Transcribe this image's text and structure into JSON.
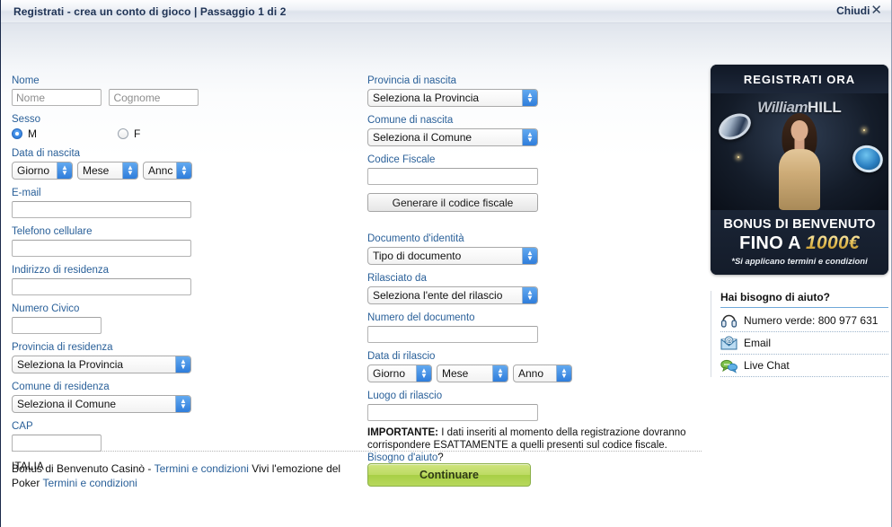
{
  "window": {
    "title": "Registrati - crea un conto di gioco  |  Passaggio 1 di 2",
    "close_label": "Chiudi",
    "close_icon": "close-x-icon"
  },
  "form": {
    "nome": {
      "label": "Nome",
      "first_placeholder": "Nome",
      "first_value": "",
      "last_placeholder": "Cognome",
      "last_value": ""
    },
    "sesso": {
      "label": "Sesso",
      "options": [
        "M",
        "F"
      ],
      "selected": "M"
    },
    "data_nascita": {
      "label": "Data di nascita",
      "day": "Giorno",
      "month": "Mese",
      "year": "Annc"
    },
    "email": {
      "label": "E-mail",
      "value": ""
    },
    "telefono": {
      "label": "Telefono cellulare",
      "value": ""
    },
    "indirizzo": {
      "label": "Indirizzo di residenza",
      "value": ""
    },
    "civico": {
      "label": "Numero Civico",
      "value": ""
    },
    "provincia_res": {
      "label": "Provincia di residenza",
      "value": "Seleziona la Provincia"
    },
    "comune_res": {
      "label": "Comune di residenza",
      "value": "Seleziona il Comune"
    },
    "cap": {
      "label": "CAP",
      "value": ""
    },
    "paese": "ITALIA",
    "provincia_nascita": {
      "label": "Provincia di nascita",
      "value": "Seleziona la Provincia"
    },
    "comune_nascita": {
      "label": "Comune di nascita",
      "value": "Seleziona il Comune"
    },
    "codice_fiscale": {
      "label": "Codice Fiscale",
      "value": ""
    },
    "genera_cf_button": "Generare il codice fiscale",
    "documento": {
      "label": "Documento d'identità",
      "value": "Tipo di documento"
    },
    "rilasciato_da": {
      "label": "Rilasciato da",
      "value": "Seleziona l'ente del rilascio"
    },
    "numero_documento": {
      "label": "Numero del documento",
      "value": ""
    },
    "data_rilascio": {
      "label": "Data di rilascio",
      "day": "Giorno",
      "month": "Mese",
      "year": "Anno"
    },
    "luogo_rilascio": {
      "label": "Luogo di rilascio",
      "value": ""
    },
    "importante": {
      "bold": "IMPORTANTE:",
      "text": " I dati inseriti al momento della registrazione dovranno corrispondere ESATTAMENTE a quelli presenti sul codice fiscale. ",
      "link": "Bisogno d'aiuto",
      "suffix": "?"
    }
  },
  "promo": {
    "header": "REGISTRATI ORA",
    "brand_first": "William",
    "brand_second": "HILL",
    "bonus_line1": "BONUS DI BENVENUTO",
    "bonus_line2_prefix": "FINO A ",
    "bonus_amount": "1000€",
    "terms": "*Si applicano termini e condizioni"
  },
  "help": {
    "title": "Hai bisogno di aiuto?",
    "items": [
      {
        "icon": "headset-icon",
        "label": "Numero verde: 800 977 631"
      },
      {
        "icon": "email-icon",
        "label": "Email"
      },
      {
        "icon": "live-chat-icon",
        "label": "Live Chat"
      }
    ]
  },
  "footer": {
    "text1": "Bonus di Benvenuto Casinò - ",
    "link1": "Termini e condizioni",
    "text2": " Vivi l'emozione del Poker ",
    "link2": "Termini e condizioni",
    "continue_button": "Continuare"
  },
  "colors": {
    "label_blue": "#2a6099",
    "link_blue": "#2a6099",
    "select_arrow": "#2f7ddb",
    "continue_green": "#b7d85c",
    "title_navy": "#1f3355"
  }
}
